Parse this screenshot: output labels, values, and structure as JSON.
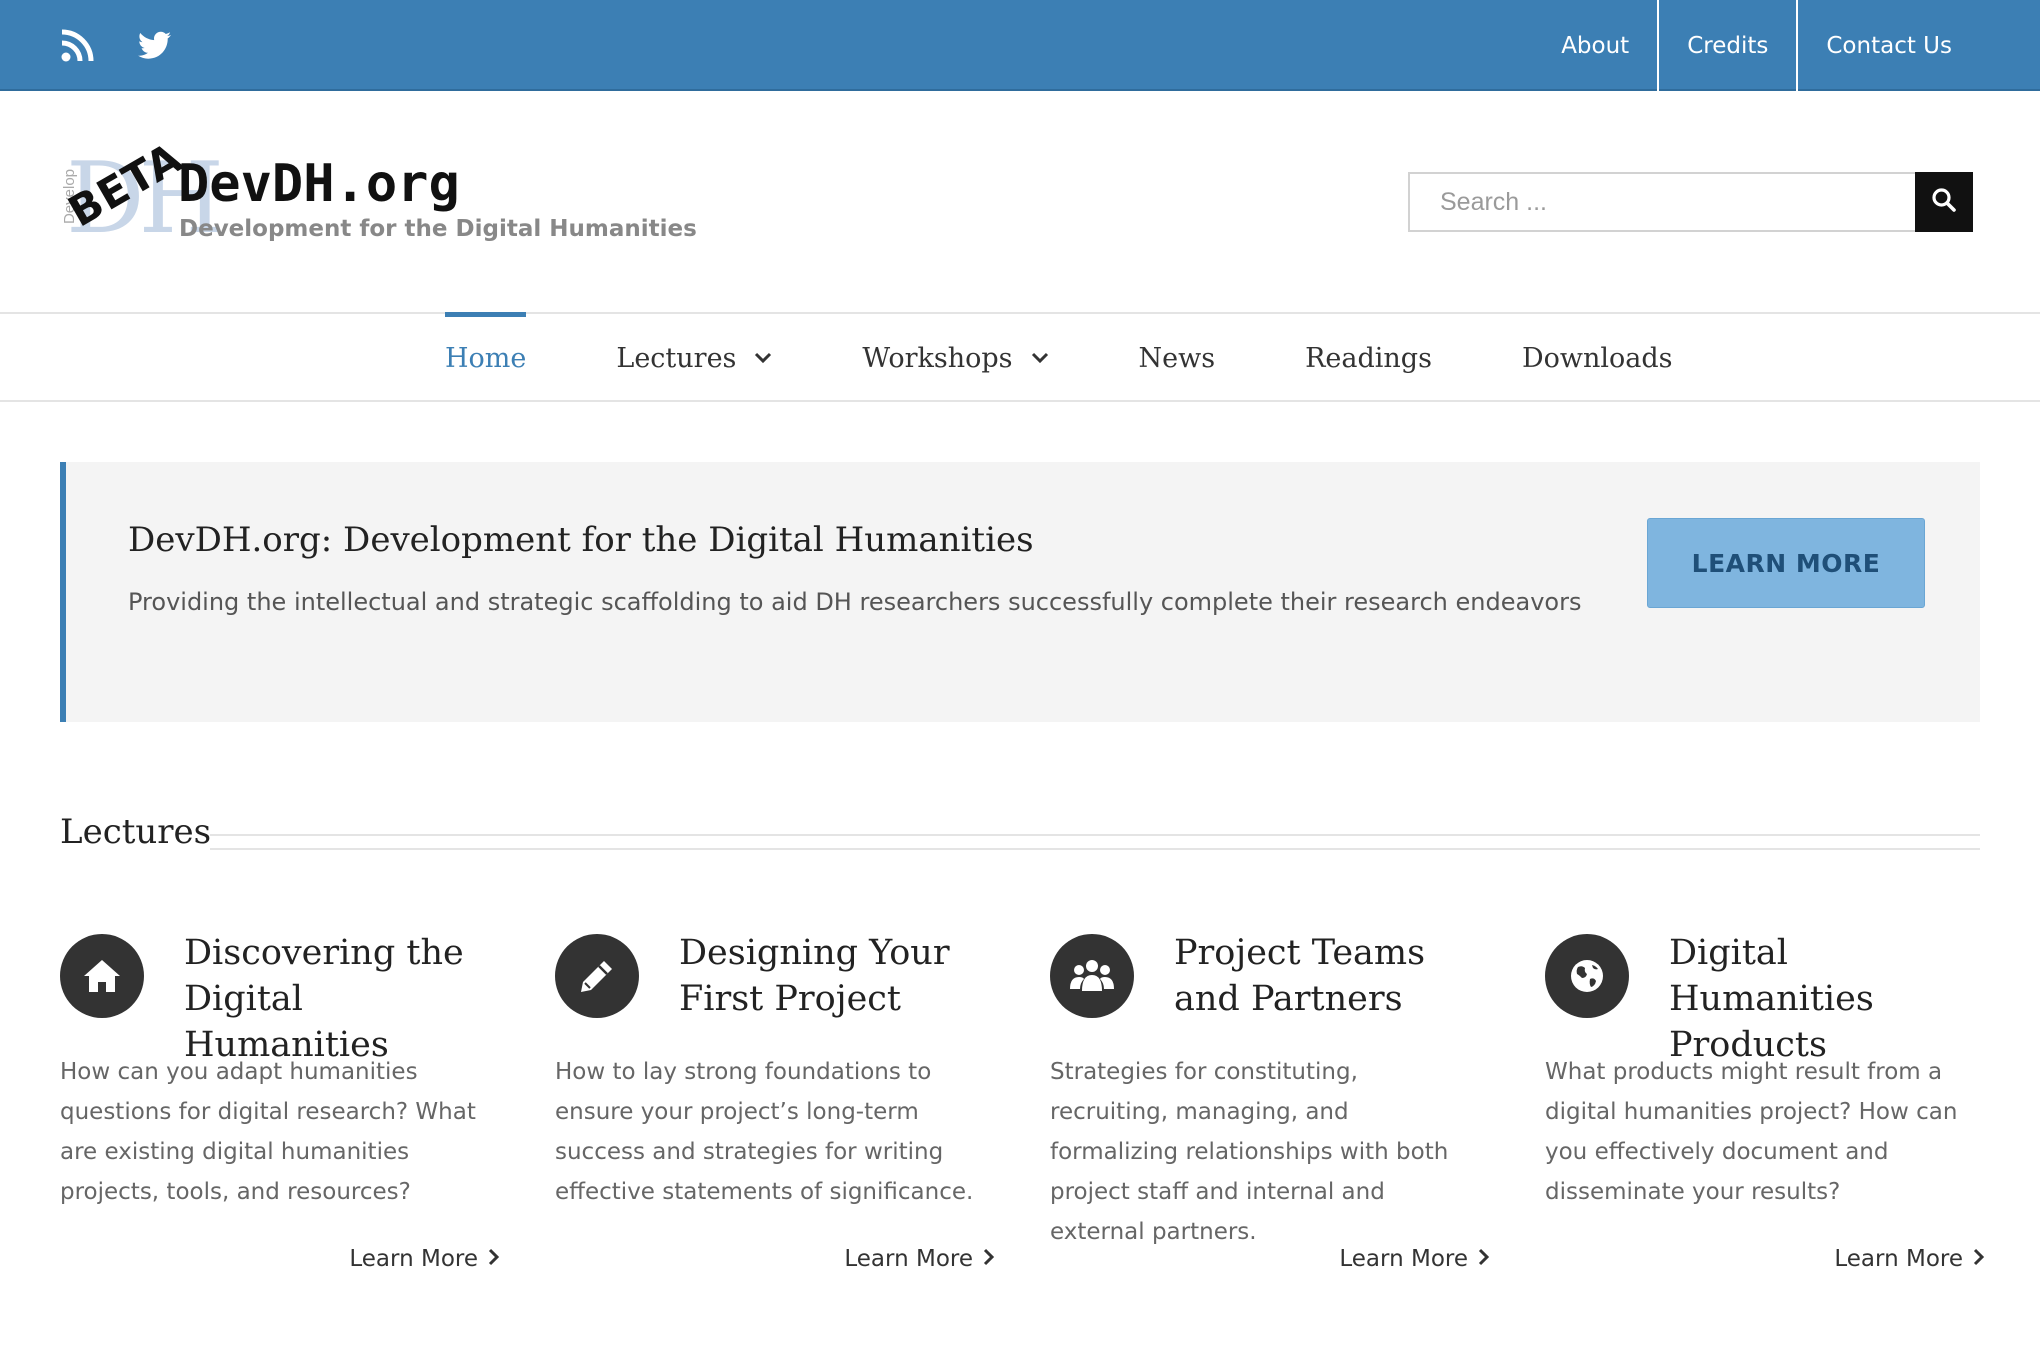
{
  "topbar": {
    "social": [
      "rss-icon",
      "twitter-icon"
    ],
    "links": [
      "About",
      "Credits",
      "Contact Us"
    ]
  },
  "logo": {
    "mark": "DH",
    "vertical_text": "Develop",
    "beta": "BETA",
    "site_name": "DevDH.org",
    "tagline": "Development for the Digital Humanities"
  },
  "search": {
    "placeholder": "Search ..."
  },
  "nav": {
    "items": [
      {
        "label": "Home",
        "active": true
      },
      {
        "label": "Lectures",
        "dropdown": true
      },
      {
        "label": "Workshops",
        "dropdown": true
      },
      {
        "label": "News"
      },
      {
        "label": "Readings"
      },
      {
        "label": "Downloads"
      }
    ]
  },
  "hero": {
    "title": "DevDH.org: Development for the Digital Humanities",
    "text": "Providing the intellectual and strategic scaffolding to aid DH researchers successfully complete their research endeavors",
    "button": "LEARN MORE"
  },
  "lectures": {
    "heading": "Lectures",
    "more_label": "Learn More",
    "cards": [
      {
        "icon": "home-icon",
        "title": "Discovering the Digital Humanities",
        "text": "How can you adapt humanities questions for digital research? What are existing digital humanities projects, tools, and resources?"
      },
      {
        "icon": "pencil-icon",
        "title": "Designing Your First Project",
        "text": "How to lay strong foundations to ensure your project’s long-term success and strategies for writing effective statements of significance."
      },
      {
        "icon": "users-icon",
        "title": "Project Teams and Partners",
        "text": "Strategies for constituting, recruiting, managing, and formalizing relationships with both project staff and internal and external partners."
      },
      {
        "icon": "globe-icon",
        "title": "Digital Humanities Products",
        "text": "What products might result from a digital humanities project? How can you effectively document and disseminate your results?"
      }
    ]
  },
  "colors": {
    "brand": "#3c7fb4",
    "button": "#7fb5df",
    "dark": "#333333"
  }
}
